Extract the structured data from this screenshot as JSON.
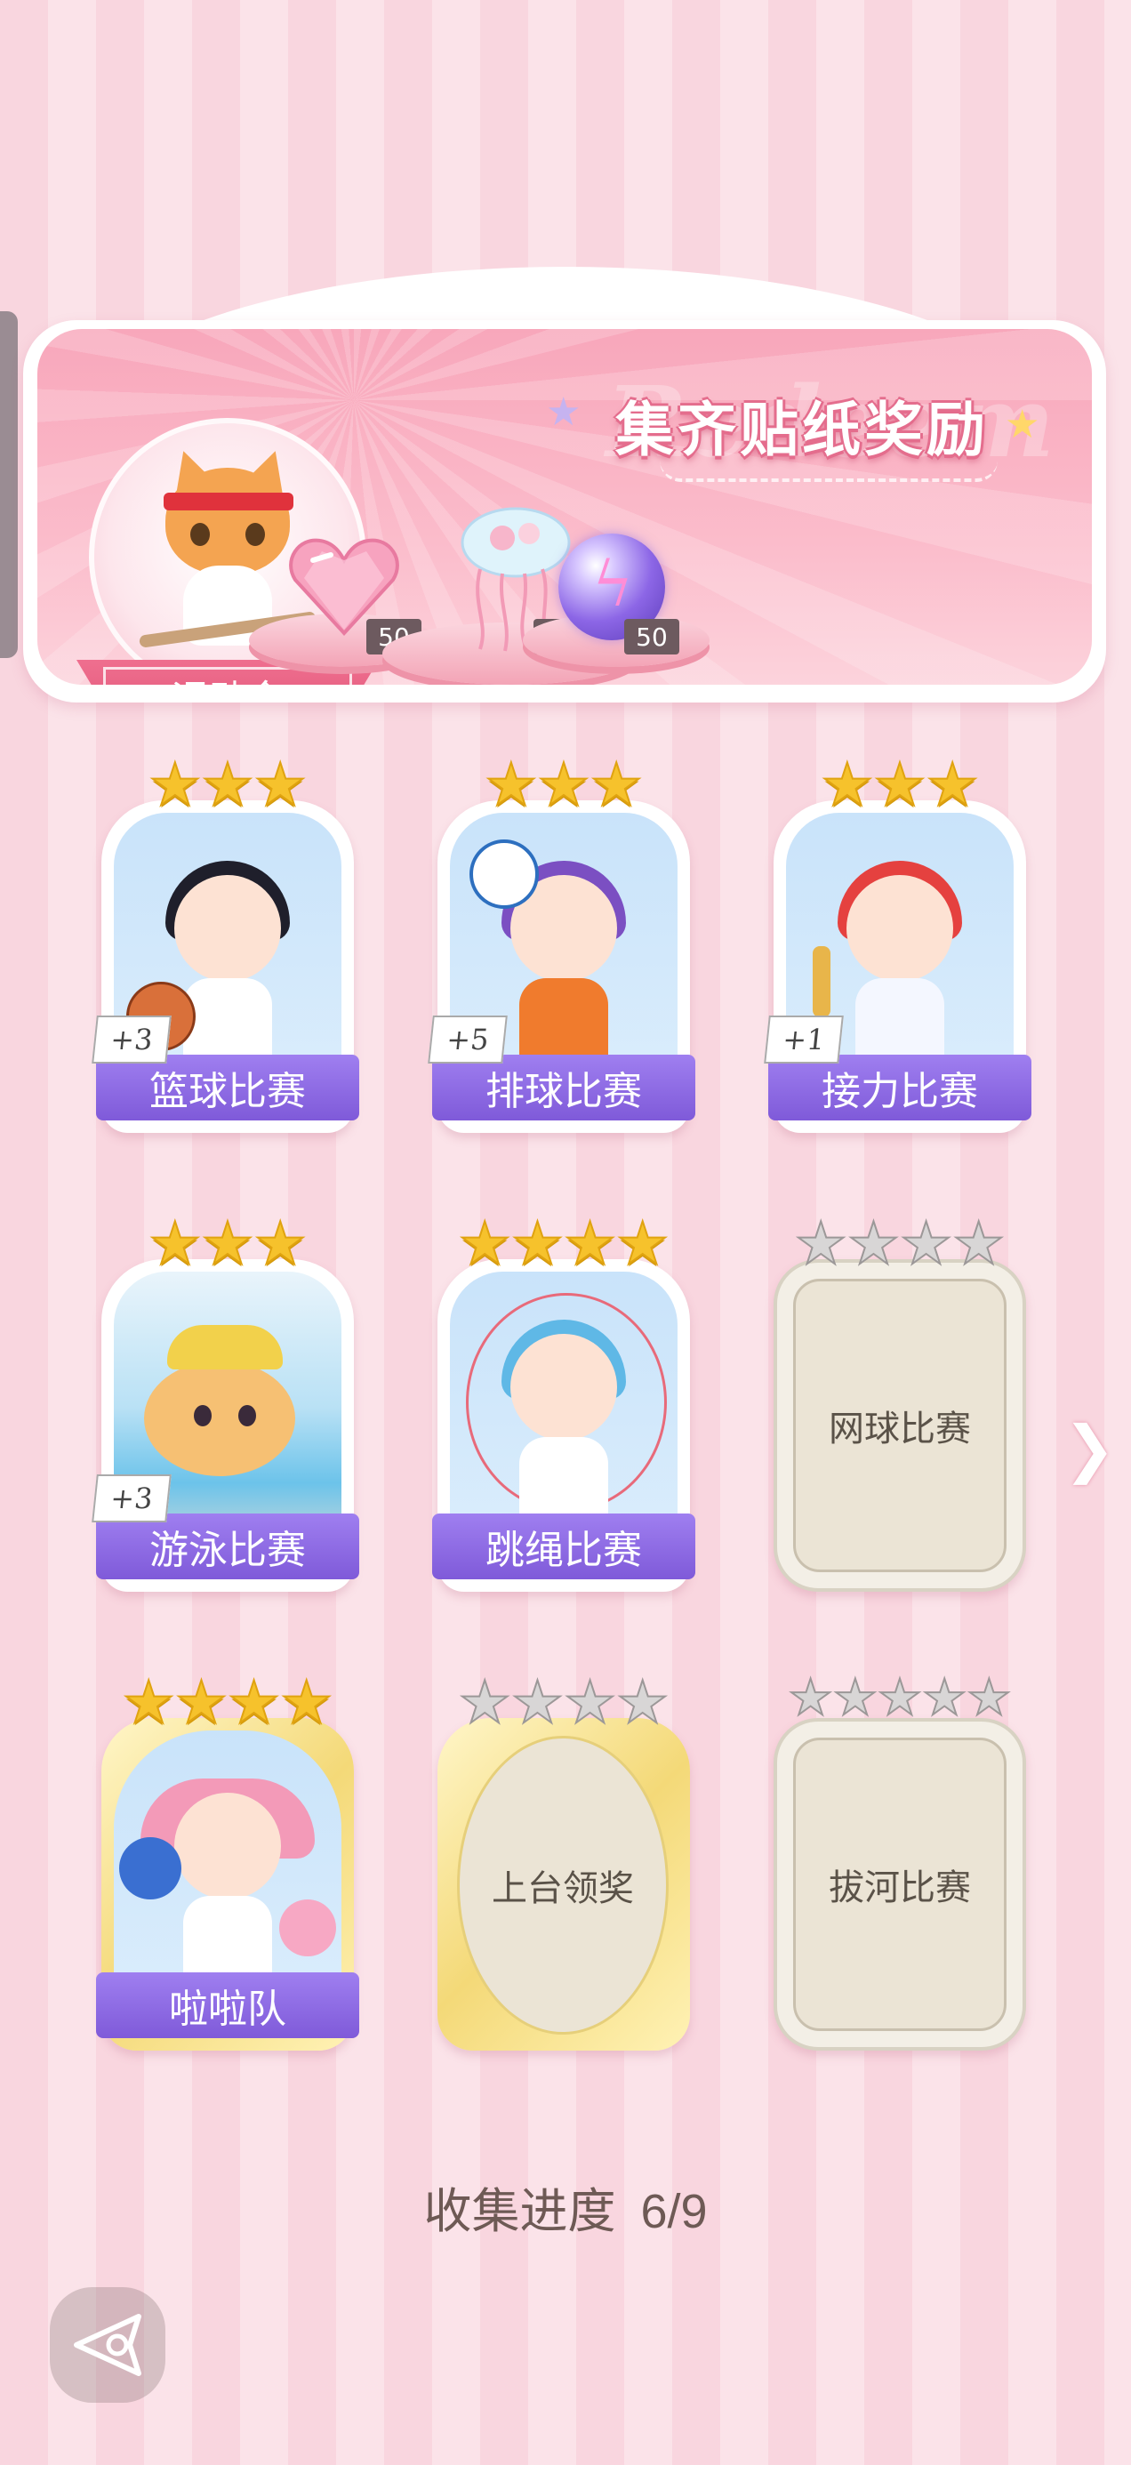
{
  "banner": {
    "title": "集齐贴纸奖励",
    "watermark": "Redeem",
    "event_name": "运动会",
    "rewards": [
      {
        "icon": "pink-heart-gem-icon",
        "count": "50"
      },
      {
        "icon": "jellyfish-bouquet-icon",
        "count": "1"
      },
      {
        "icon": "purple-lightning-orb-icon",
        "count": "50"
      }
    ]
  },
  "stickers": [
    {
      "name": "篮球比赛",
      "stars_gold": 3,
      "stars_total": 3,
      "bonus": "+3",
      "collected": true
    },
    {
      "name": "排球比赛",
      "stars_gold": 3,
      "stars_total": 3,
      "bonus": "+5",
      "collected": true
    },
    {
      "name": "接力比赛",
      "stars_gold": 3,
      "stars_total": 3,
      "bonus": "+1",
      "collected": true
    },
    {
      "name": "游泳比赛",
      "stars_gold": 3,
      "stars_total": 3,
      "bonus": "+3",
      "collected": true
    },
    {
      "name": "跳绳比赛",
      "stars_gold": 4,
      "stars_total": 4,
      "bonus": "",
      "collected": true
    },
    {
      "name": "网球比赛",
      "stars_gold": 0,
      "stars_total": 4,
      "bonus": "",
      "collected": false
    },
    {
      "name": "啦啦队",
      "stars_gold": 4,
      "stars_total": 4,
      "bonus": "",
      "collected": true
    },
    {
      "name": "上台领奖",
      "stars_gold": 0,
      "stars_total": 4,
      "bonus": "",
      "collected": false
    },
    {
      "name": "拔河比赛",
      "stars_gold": 0,
      "stars_total": 5,
      "bonus": "",
      "collected": false
    }
  ],
  "progress": {
    "label": "收集进度",
    "value": "6/9",
    "fraction": 0.667
  },
  "colors": {
    "label_purple": "#8f6de6",
    "banner_pink": "#f8a7bb",
    "star_gold": "#f6c22c"
  },
  "icons": {
    "next": "chevron-right-icon",
    "back": "back-triangle-icon"
  }
}
